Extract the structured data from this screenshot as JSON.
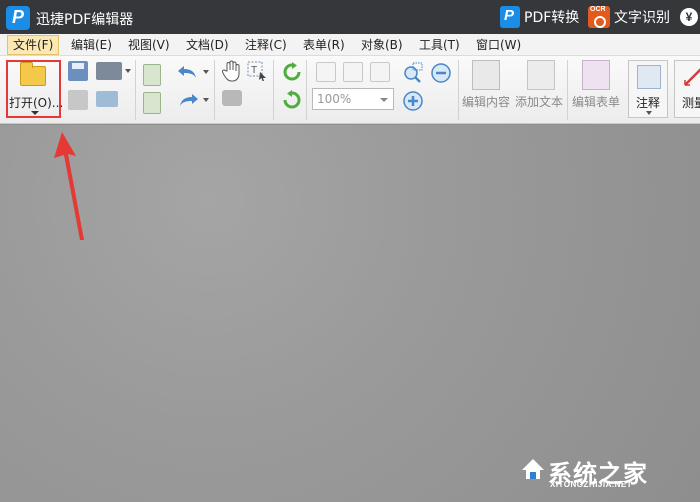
{
  "titlebar": {
    "app_title": "迅捷PDF编辑器",
    "pdf_convert_label": "PDF转换",
    "ocr_label": "文字识别",
    "ocr_badge": "OCR",
    "yen_symbol": "¥"
  },
  "menu": {
    "items": [
      "文件(F)",
      "编辑(E)",
      "视图(V)",
      "文档(D)",
      "注释(C)",
      "表单(R)",
      "对象(B)",
      "工具(T)",
      "窗口(W)"
    ],
    "active_index": 0
  },
  "toolbar": {
    "open_label": "打开(O)...",
    "zoom_value": "100%",
    "edit_content_label": "编辑内容",
    "add_text_label": "添加文本",
    "edit_form_label": "编辑表单",
    "annotation_label": "注释",
    "measure_label": "测量"
  },
  "watermark": {
    "text": "系统之家",
    "sub": "XITONGZHIJIA.NET"
  },
  "colors": {
    "highlight_red": "#e53935",
    "titlebar_bg": "#35373a",
    "brand_blue": "#1a8ee6",
    "ocr_orange": "#e25b1c"
  }
}
